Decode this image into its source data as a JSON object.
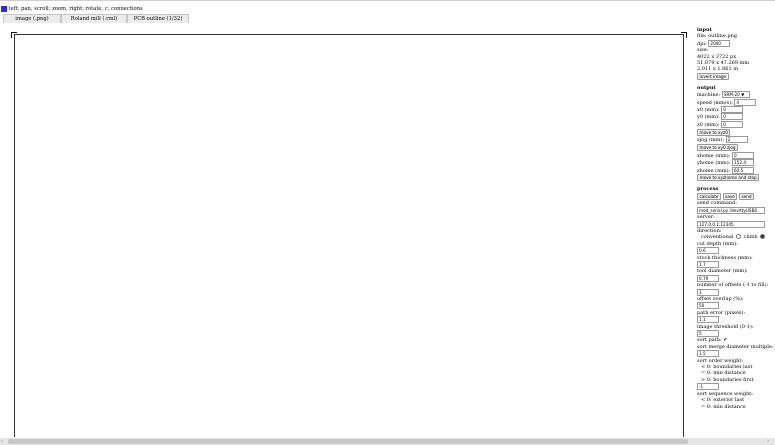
{
  "header": {
    "text": "left: pan, scroll: zoom, right: rotate, c: connections"
  },
  "tabs": [
    {
      "label": "image (.png)"
    },
    {
      "label": "Roland mill (.rml)"
    },
    {
      "label": "PCB outline (1/32)"
    }
  ],
  "input": {
    "title": "input",
    "file_label": "file: outline.png",
    "dpi_label": "dpi:",
    "dpi_value": "2000",
    "size_label": "size:",
    "size_px": "4022 x 3722 px",
    "size_mm": "51.079 x 47.269 mm",
    "size_in": "2.011 x 1.861 in",
    "invert_button": "invert image"
  },
  "output": {
    "title": "output",
    "machine_label": "machine:",
    "machine_value": "SRM-20 ▼",
    "speed_label": "speed (mm/s):",
    "speed_value": "4",
    "x0_label": "x0 (mm):",
    "x0_value": "0",
    "y0_label": "y0 (mm):",
    "y0_value": "0",
    "z0_label": "z0 (mm):",
    "z0_value": "0",
    "move_xyz0_button": "move to xyz0",
    "zjog_label": "zjog (mm):",
    "zjog_value": "2",
    "move_xy0_button": "move to xy0 zjog",
    "xhome_label": "xhome (mm):",
    "xhome_value": "0",
    "yhome_label": "yhome (mm):",
    "yhome_value": "152.4",
    "zhome_label": "zhome (mm):",
    "zhome_value": "60.5",
    "move_home_button": "move to xyzhome and stop"
  },
  "process": {
    "title": "process",
    "calculate_button": "calculate",
    "save_button": "save",
    "send_button": "send",
    "send_command_label": "send command:",
    "send_command_value": "mod_serial.py /dev/ttyUSB0",
    "server_label": "server:",
    "server_value": "127.0.0.1:12345",
    "direction_label": "direction:",
    "conventional_label": "conventional",
    "climb_label": "climb",
    "cut_depth_label": "cut depth (mm):",
    "cut_depth_value": "0.6",
    "stock_label": "stock thickness (mm):",
    "stock_value": "1.7",
    "tool_diameter_label": "tool diameter (mm):",
    "tool_diameter_value": "0.79",
    "offsets_label": "number of offsets (-1 to fill):",
    "offsets_value": "1",
    "overlap_label": "offset overlap (%):",
    "overlap_value": "50",
    "path_error_label": "path error (pixels):",
    "path_error_value": "1.1",
    "threshold_label": "image threshold (0-1):",
    "threshold_value": "5",
    "sort_path_label": "sort path:",
    "sort_path_check": "✔",
    "merge_label": "sort merge diameter multiple:",
    "merge_value": "1.5",
    "order_weight_label": "sort order weight:",
    "order_lt": "< 0: boundaries last",
    "order_eq": "= 0: min distance",
    "order_gt": "> 0: boundaries first",
    "order_value": "-1",
    "sequence_weight_label": "sort sequence weight:",
    "seq_lt": "< 0: exterior last",
    "seq_eq": "= 0: min distance"
  },
  "scrollbar": {
    "left_arrow": "‹",
    "right_arrow": "›"
  }
}
